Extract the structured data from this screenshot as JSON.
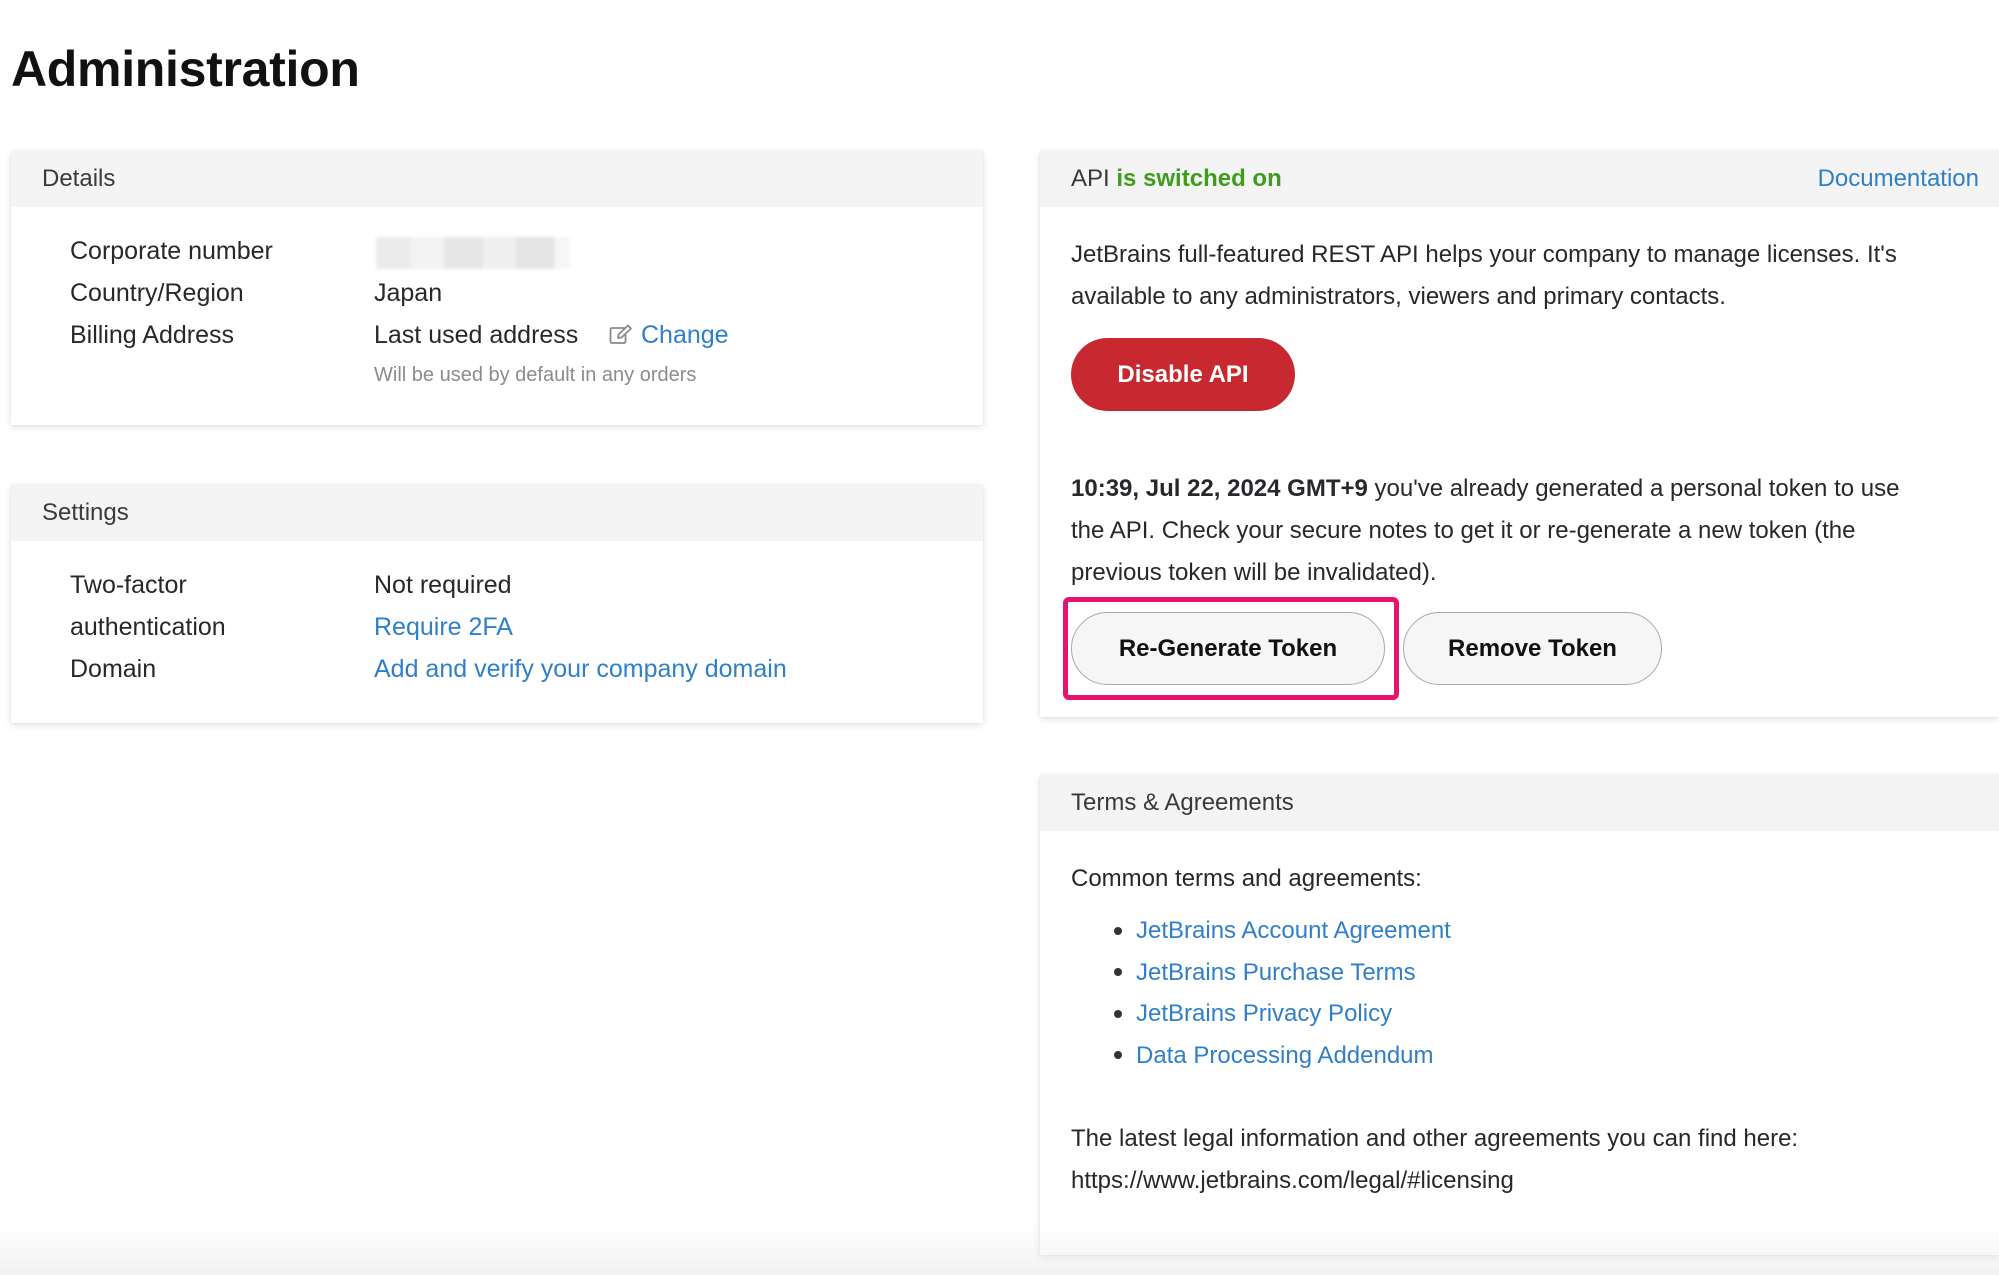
{
  "page": {
    "title": "Administration"
  },
  "details": {
    "header": "Details",
    "rows": [
      {
        "label": "Corporate number",
        "value": ""
      },
      {
        "label": "Country/Region",
        "value": "Japan"
      },
      {
        "label": "Billing Address",
        "value": "Last used address",
        "action": "Change",
        "note": "Will be used by default in any orders"
      }
    ]
  },
  "settings": {
    "header": "Settings",
    "two_factor_label_line1": "Two-factor",
    "two_factor_label_line2": "authentication",
    "two_factor_value": "Not required",
    "two_factor_action": "Require 2FA",
    "domain_label": "Domain",
    "domain_action": "Add and verify your company domain"
  },
  "api": {
    "header_prefix": "API",
    "header_status": "is switched on",
    "documentation_link": "Documentation",
    "description_line1": "JetBrains full-featured REST API helps your company to manage licenses. It's",
    "description_line2": "available to any administrators, viewers and primary contacts.",
    "disable_button": "Disable API",
    "token_timestamp": "10:39, Jul 22, 2024 GMT+9",
    "token_text_line1": " you've already generated a personal token to use",
    "token_text_line2": "the API. Check your secure notes to get it or re-generate a new token (the",
    "token_text_line3": "previous token will be invalidated).",
    "regenerate_button": "Re-Generate Token",
    "remove_button": "Remove Token",
    "status_color": "#3f9c1f",
    "danger_color": "#c8282f",
    "highlight_color": "#e8136e"
  },
  "terms": {
    "header": "Terms & Agreements",
    "intro": "Common terms and agreements:",
    "links": [
      "JetBrains Account Agreement",
      "JetBrains Purchase Terms",
      "JetBrains Privacy Policy",
      "Data Processing Addendum"
    ],
    "footer_text": "The latest legal information and other agreements you can find here:",
    "footer_link": "https://www.jetbrains.com/legal/#licensing"
  },
  "colors": {
    "link": "#2f7fc9",
    "header_bg": "#f4f4f4"
  }
}
